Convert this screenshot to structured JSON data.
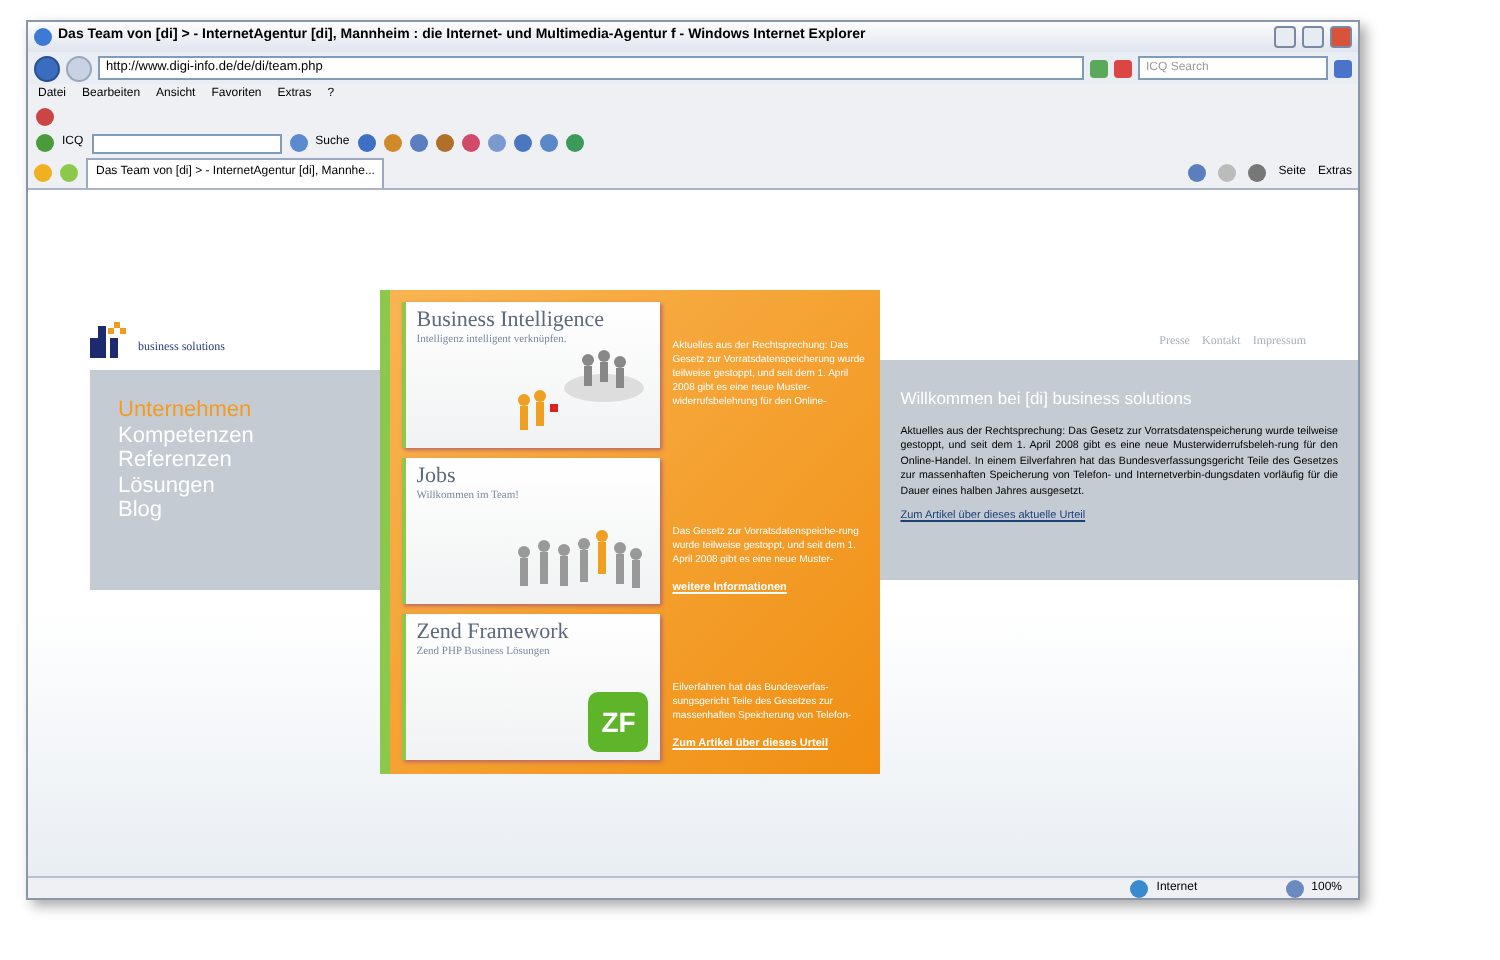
{
  "window": {
    "title": "Das Team von [di] >   - InternetAgentur [di], Mannheim : die Internet- und Multimedia-Agentur f - Windows Internet Explorer"
  },
  "address_bar": {
    "url": "http://www.digi-info.de/de/di/team.php",
    "search_placeholder": "ICQ Search"
  },
  "menu": [
    "Datei",
    "Bearbeiten",
    "Ansicht",
    "Favoriten",
    "Extras",
    "?"
  ],
  "toolbar": {
    "icq_label": "ICQ",
    "search_label": "Suche"
  },
  "tabs": [
    {
      "label": "Das Team von [di] >   - InternetAgentur [di], Mannhe...",
      "selected": true
    }
  ],
  "command_bar": [
    "Seite",
    "Extras"
  ],
  "page": {
    "logo_text": "business solutions",
    "nav": [
      {
        "label": "Unternehmen",
        "selected": true
      },
      {
        "label": "Kompetenzen",
        "selected": false
      },
      {
        "label": "Referenzen",
        "selected": false
      },
      {
        "label": "Lösungen",
        "selected": false
      },
      {
        "label": "Blog",
        "selected": false
      }
    ],
    "teasers": [
      {
        "kind": "people",
        "title": "Business Intelligence",
        "subtitle": "Intelligenz intelligent verknüpfen.",
        "text": "Aktuelles aus der Rechtsprechung: Das Gesetz zur Vorratsdatenspeicherung wurde teilweise gestoppt, und seit dem 1. April 2008 gibt es eine neue Muster-widerrufsbelehrung für den Online-"
      },
      {
        "kind": "crowd",
        "title": "Jobs",
        "subtitle": "Willkommen im Team!",
        "text": "Das Gesetz zur Vorratsdatenspeiche-rung wurde teilweise gestoppt, und seit dem 1. April 2008 gibt es eine neue Muster-",
        "link": "weitere Informationen"
      },
      {
        "kind": "zf",
        "title": "Zend Framework",
        "subtitle": "Zend PHP Business Lösungen",
        "logo_text": "ZF",
        "text": "Eilverfahren hat das Bundesverfas-sungsgericht Teile des Gesetzes zur massenhaften Speicherung von Telefon-",
        "link": "Zum Artikel über dieses  Urteil"
      }
    ],
    "top_links": [
      "Presse",
      "Kontakt",
      "Impressum"
    ],
    "welcome": {
      "title": "Willkommen bei [di] business solutions",
      "text": "Aktuelles aus der Rechtsprechung: Das Gesetz zur Vorratsdatenspeicherung wurde teilweise gestoppt, und seit dem 1. April 2008 gibt es eine neue Musterwiderrufsbeleh-rung für den Online-Handel. In einem Eilverfahren hat das Bundesverfassungsgericht Teile des Gesetzes zur massenhaften Speicherung von Telefon- und Internetverbin-dungsdaten vorläufig für die Dauer eines halben Jahres ausgesetzt.",
      "link": "Zum Artikel über dieses aktuelle Urteil"
    }
  },
  "status_bar": {
    "zone": "Internet",
    "zoom": "100%"
  }
}
